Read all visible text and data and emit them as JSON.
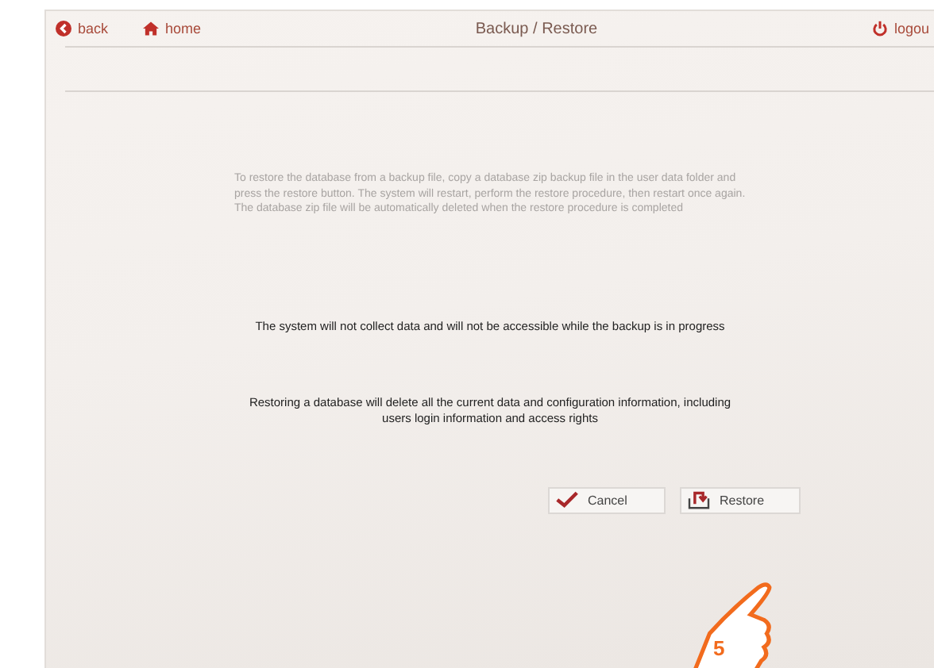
{
  "header": {
    "back": "back",
    "home": "home",
    "title": "Backup / Restore",
    "logout": "logou"
  },
  "info": "To restore the database from a backup file, copy a database zip backup file in the user data folder and press the restore button. The system will restart, perform the restore procedure, then restart once again. The database zip file will be automatically deleted when the restore procedure is completed",
  "notices": [
    "The system will not collect data and will not be accessible while the backup is in progress",
    "Restoring a database will delete all the current data and configuration information, including users login information and access rights"
  ],
  "buttons": [
    {
      "kind": "cancel",
      "label": "Cancel"
    },
    {
      "kind": "restore",
      "label": "Restore"
    }
  ],
  "callout": {
    "label": "5"
  }
}
